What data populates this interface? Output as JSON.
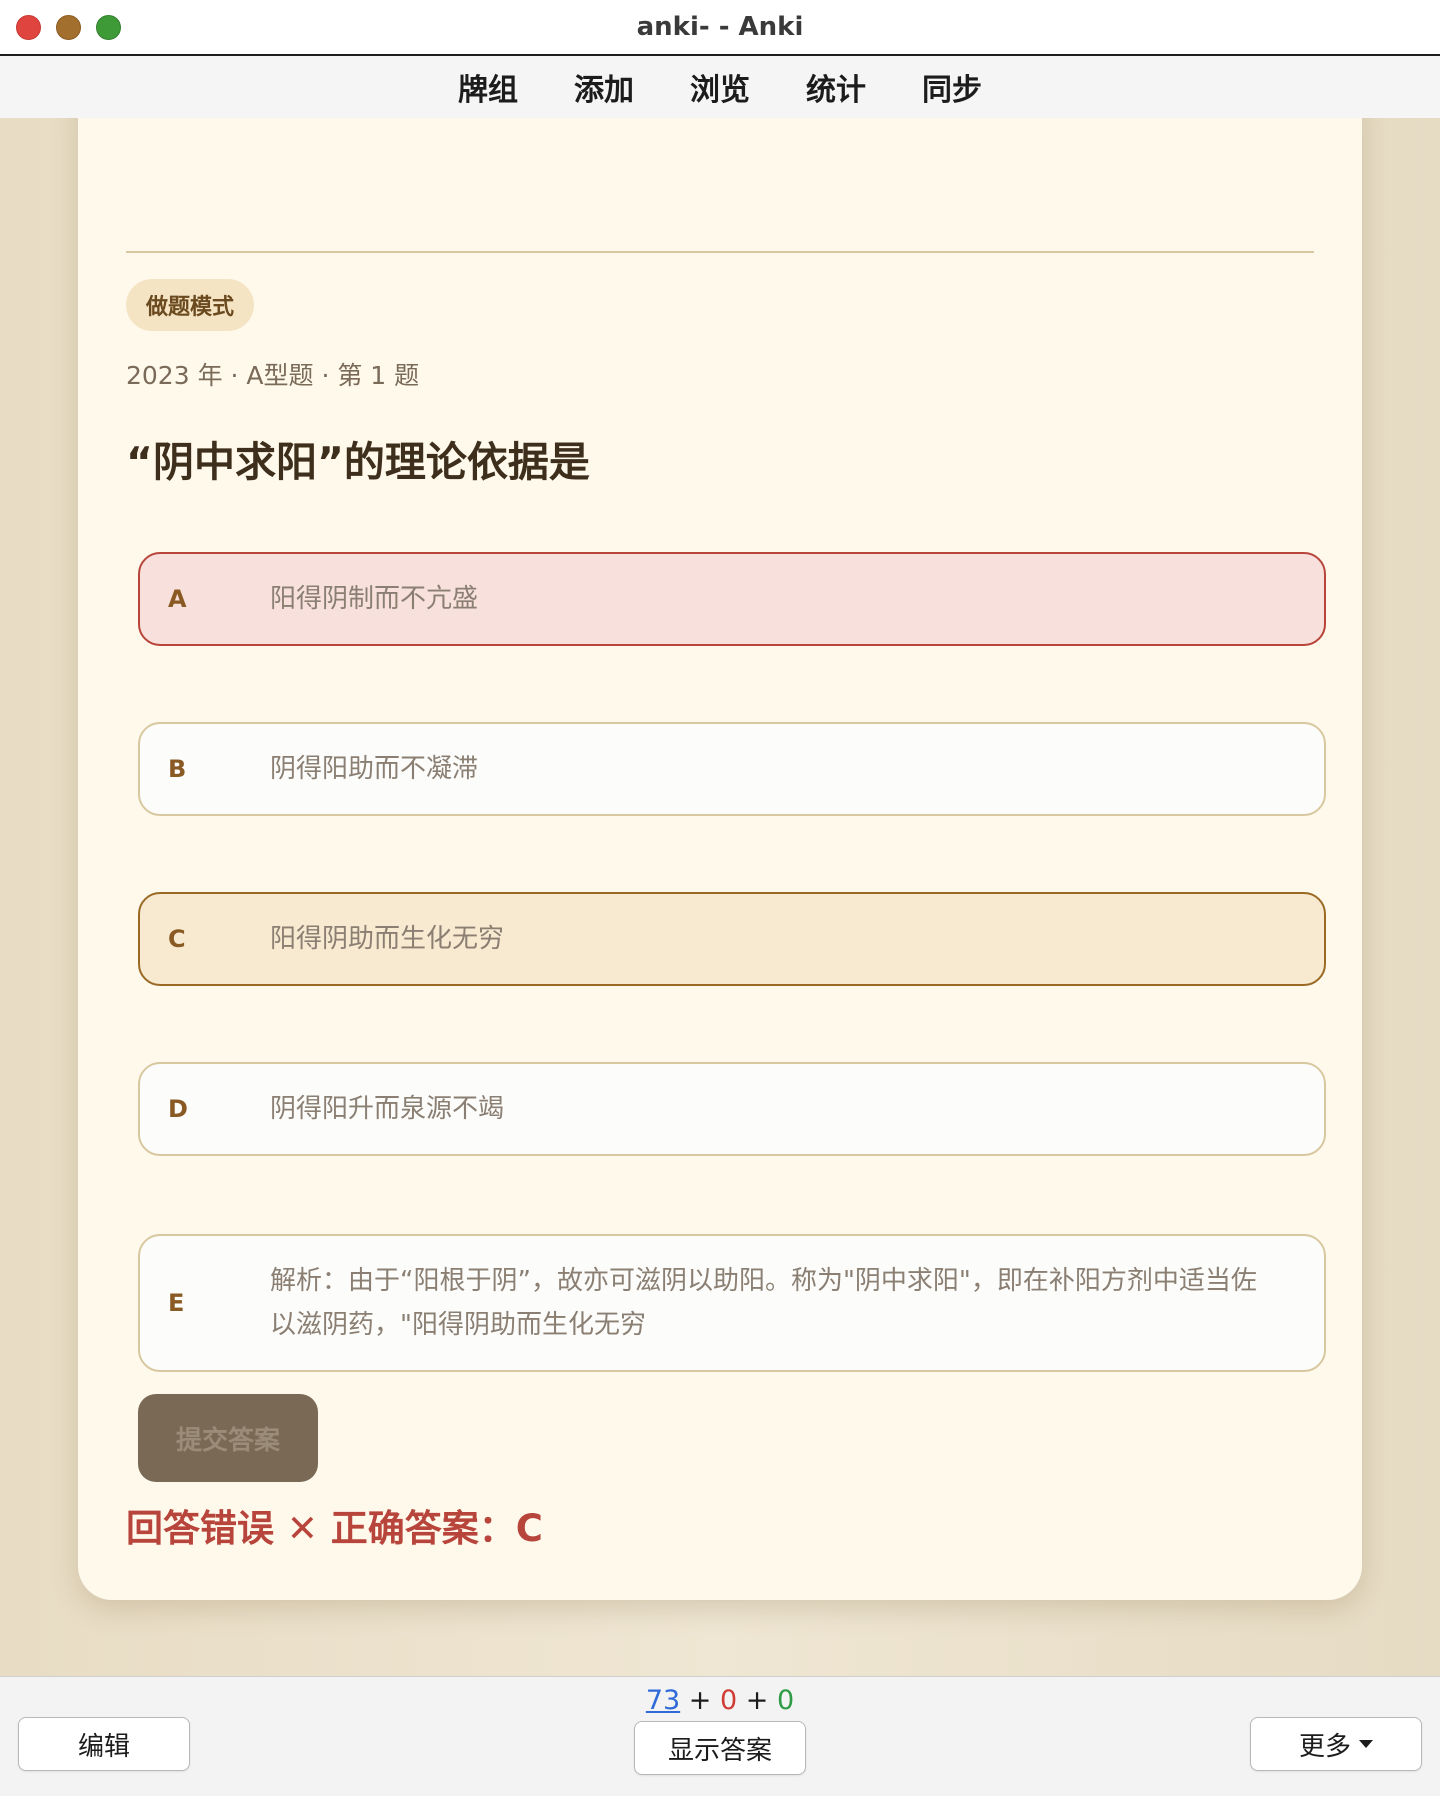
{
  "window": {
    "title": "anki- - Anki"
  },
  "toolbar": {
    "items": [
      "牌组",
      "添加",
      "浏览",
      "统计",
      "同步"
    ]
  },
  "card": {
    "mode_badge": "做题模式",
    "meta": "2023 年 · A型题 · 第 1 题",
    "question": "“阴中求阳”的理论依据是",
    "options": [
      {
        "letter": "A",
        "text": "阳得阴制而不亢盛",
        "state": "selected-wrong"
      },
      {
        "letter": "B",
        "text": "阴得阳助而不凝滞",
        "state": "normal"
      },
      {
        "letter": "C",
        "text": "阳得阴助而生化无穷",
        "state": "correct"
      },
      {
        "letter": "D",
        "text": "阴得阳升而泉源不竭",
        "state": "normal"
      },
      {
        "letter": "E",
        "text": "解析：由于“阳根于阴”，故亦可滋阴以助阳。称为\"阴中求阳\"，即在补阳方剂中适当佐以滋阴药，\"阳得阴助而生化无穷",
        "state": "normal"
      }
    ],
    "submit_label": "提交答案",
    "result_text": "回答错误 ✕ 正确答案：C"
  },
  "bottombar": {
    "counts": {
      "new": "73",
      "learn": "0",
      "review": "0",
      "sep": "+"
    },
    "edit_label": "编辑",
    "show_answer_label": "显示答案",
    "more_label": "更多"
  },
  "colors": {
    "wrong": "#b8453c",
    "correct_bg": "#f7ead0",
    "wrong_bg": "#f8e1dc",
    "card_bg": "#fff9ec"
  }
}
